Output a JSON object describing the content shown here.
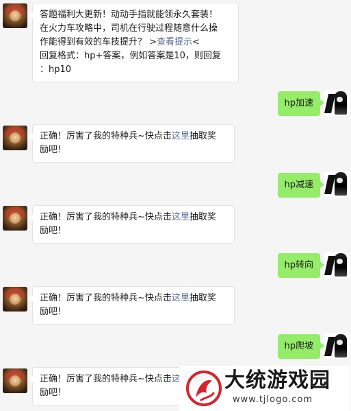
{
  "messages": {
    "m1": {
      "line1": "答题福利大更新！动动手指就能领永久套装！",
      "line2": "在火力车攻略中，司机在行驶过程随意什么操",
      "line3_pre": "作能得到有效的车技提升？ >",
      "line3_link": "查看提示",
      "line3_post": "<",
      "line4": "回复格式：hp+答案，例如答案是10，则回复",
      "line5": "：hp10"
    },
    "reply1": "hp加速",
    "reply2": "hp减速",
    "reply3": "hp转向",
    "reply4": "hp爬坡",
    "correct": {
      "pre": "正确！厉害了我的特种兵~快点击",
      "link": "这里",
      "post": "抽取奖",
      "line2": "励吧！"
    }
  },
  "watermark": {
    "title": "大统游戏园",
    "url": "www.tjlogo.com"
  },
  "colors": {
    "background": "#f5f5f5",
    "bubble_in": "#ffffff",
    "bubble_out": "#95ec69",
    "link": "#576b95",
    "logo_red": "#d8232a"
  }
}
